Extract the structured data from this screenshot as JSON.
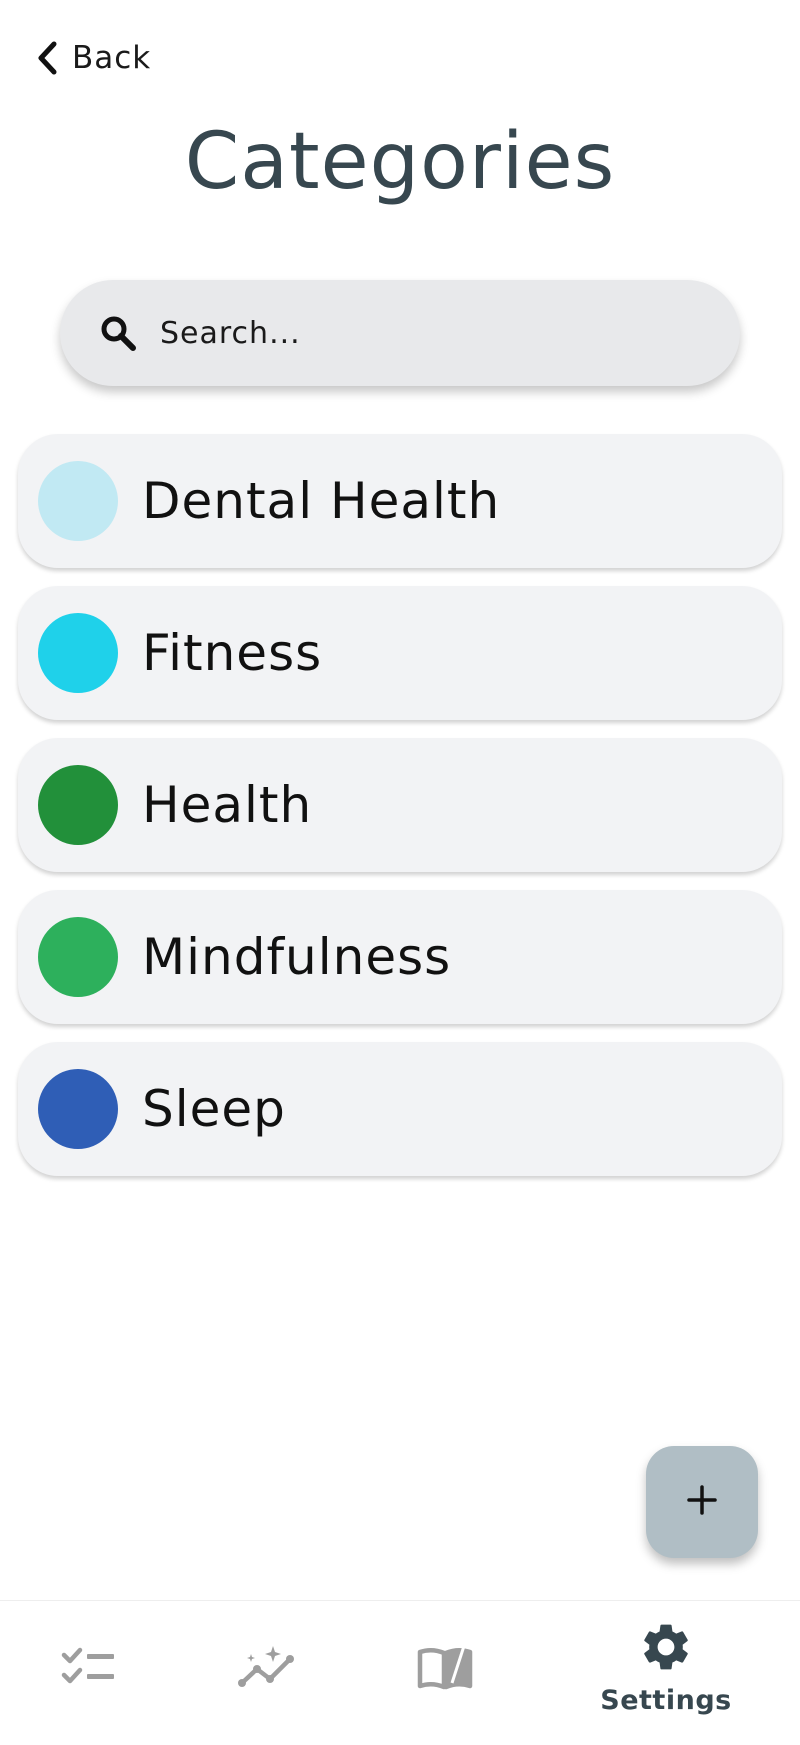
{
  "header": {
    "back_label": "Back",
    "title": "Categories"
  },
  "search": {
    "placeholder": "Search...",
    "value": ""
  },
  "categories": [
    {
      "label": "Dental Health",
      "color": "#c1e9f3"
    },
    {
      "label": "Fitness",
      "color": "#1fd1ea"
    },
    {
      "label": "Health",
      "color": "#22903a"
    },
    {
      "label": "Mindfulness",
      "color": "#2db05c"
    },
    {
      "label": "Sleep",
      "color": "#2f5eb6"
    }
  ],
  "fab": {
    "icon": "plus-icon"
  },
  "bottom_nav": {
    "items": [
      {
        "icon": "checklist-icon",
        "label": ""
      },
      {
        "icon": "insights-icon",
        "label": ""
      },
      {
        "icon": "book-icon",
        "label": ""
      },
      {
        "icon": "gear-icon",
        "label": "Settings",
        "active": true
      }
    ]
  },
  "colors": {
    "title": "#37474f",
    "fab": "#b0bec5",
    "nav_inactive": "#9e9e9e",
    "nav_active": "#37474f"
  }
}
